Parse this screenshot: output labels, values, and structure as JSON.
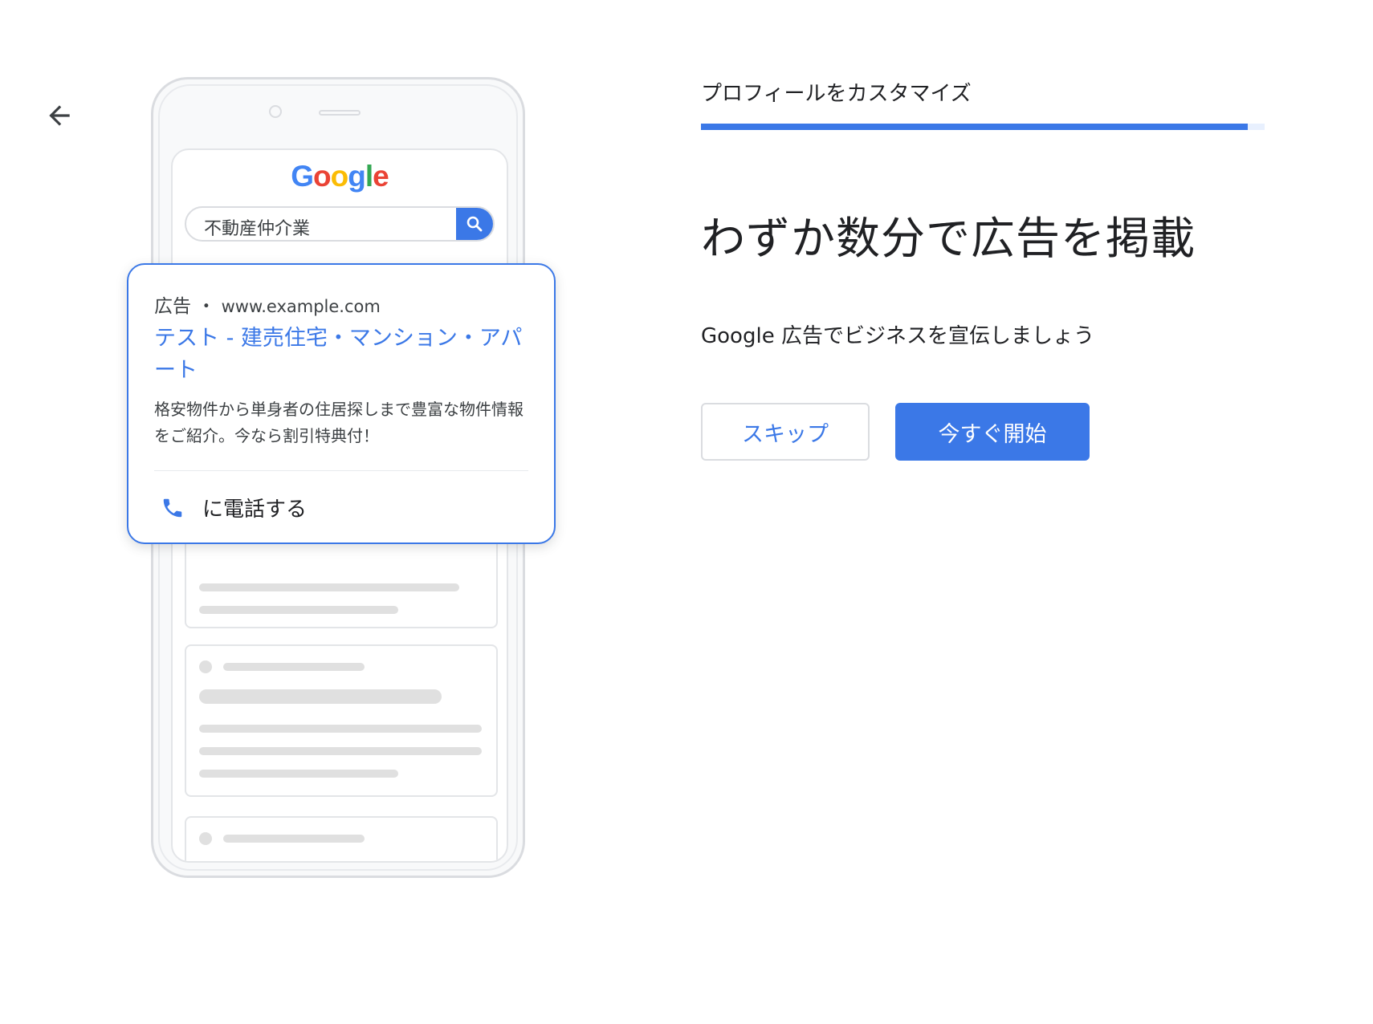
{
  "header": {
    "step_title": "プロフィールをカスタマイズ",
    "progress_percent": 97
  },
  "main": {
    "headline": "わずか数分で広告を掲載",
    "subtext": "Google 広告でビジネスを宣伝しましょう",
    "skip_label": "スキップ",
    "start_label": "今すぐ開始"
  },
  "preview": {
    "logo_letters": [
      "G",
      "o",
      "o",
      "g",
      "l",
      "e"
    ],
    "logo_colors": [
      "#4285F4",
      "#EA4335",
      "#FBBC05",
      "#4285F4",
      "#34A853",
      "#EA4335"
    ],
    "search_query": "不動産仲介業",
    "ad": {
      "label": "広告",
      "separator": "・",
      "url": "www.example.com",
      "title": "テスト - 建売住宅・マンション・アパート",
      "description": "格安物件から単身者の住居探しまで豊富な物件情報をご紹介。今なら割引特典付！",
      "call_label": "に電話する"
    }
  },
  "icons": {
    "back": "arrow-back-icon",
    "search": "search-icon",
    "phone": "phone-icon"
  },
  "colors": {
    "accent": "#3b78e7",
    "border": "#dadce0",
    "placeholder": "#e0e0e0"
  }
}
